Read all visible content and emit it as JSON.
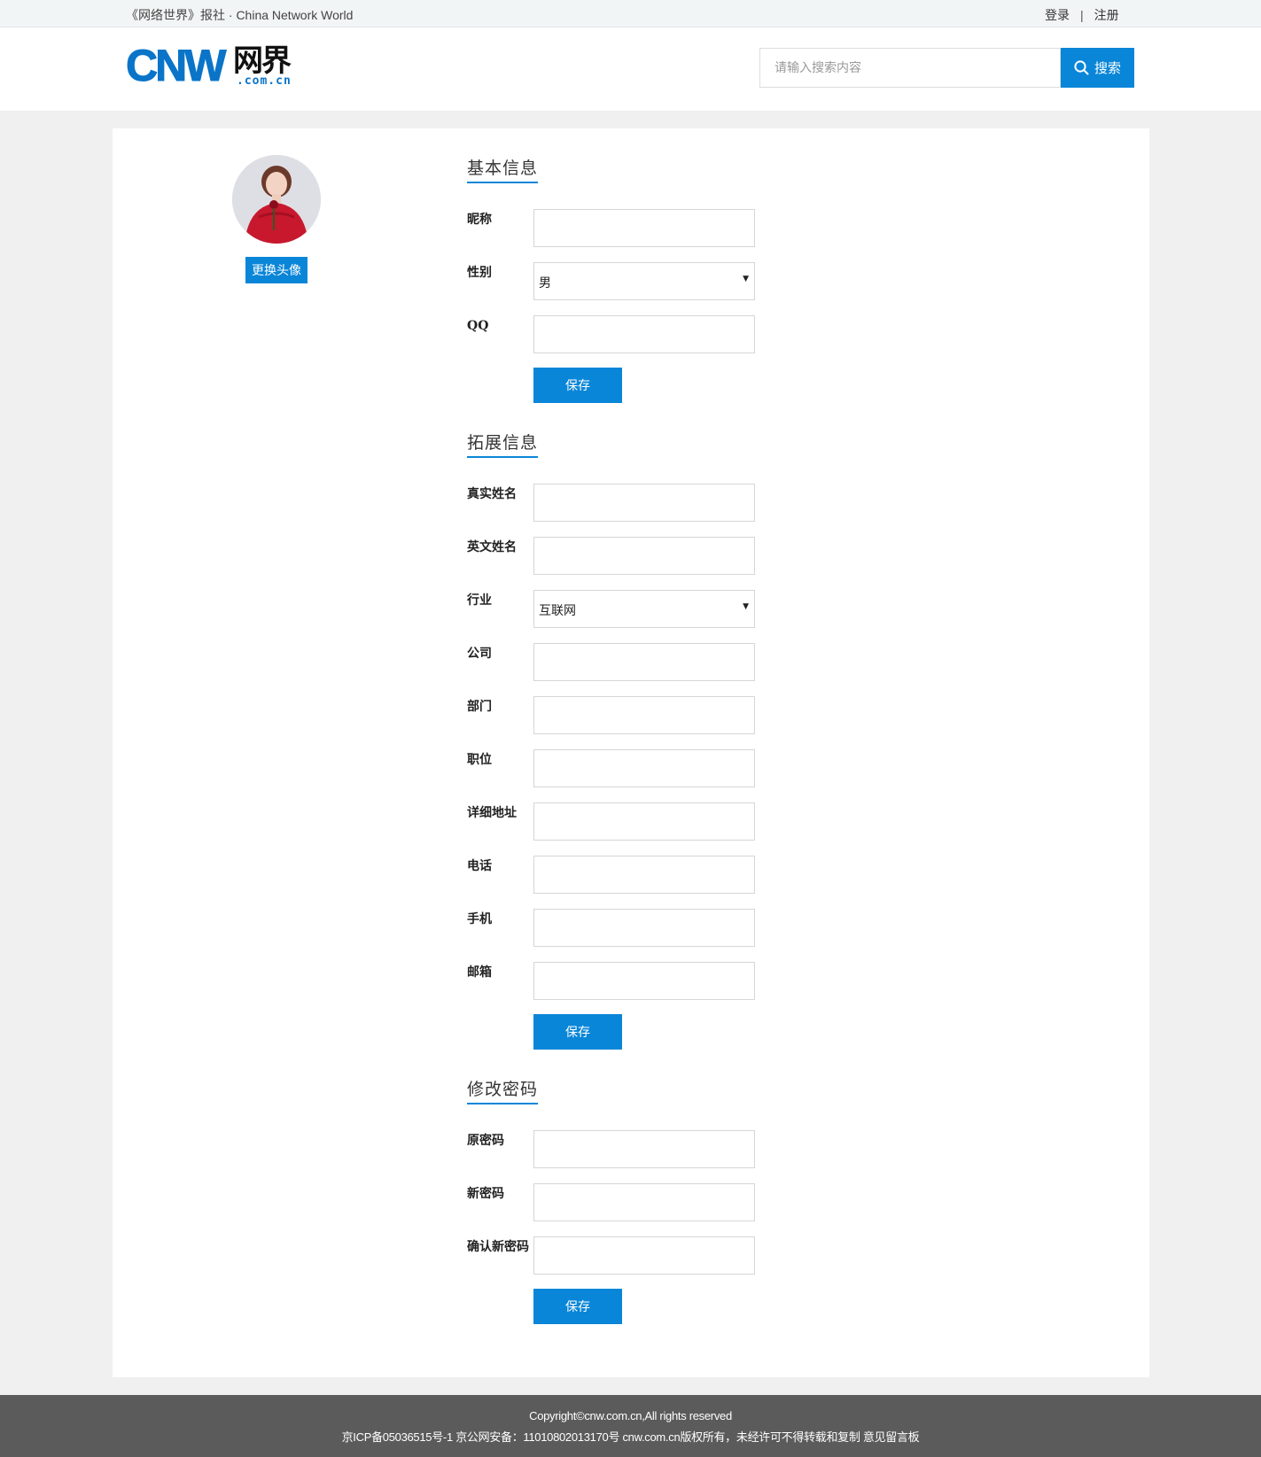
{
  "topbar": {
    "site_title": "《网络世界》报社 · China Network World",
    "login": "登录",
    "separator": "|",
    "register": "注册"
  },
  "header": {
    "logo": {
      "brand": "CNW",
      "chinese": "网界",
      "domain": ".com.cn"
    },
    "search": {
      "placeholder": "请输入搜索内容",
      "button_label": "搜索",
      "icon": "search-icon"
    }
  },
  "profile": {
    "change_avatar_label": "更换头像"
  },
  "basic_info": {
    "title": "基本信息",
    "nickname_label": "昵称",
    "nickname_value": "",
    "gender_label": "性别",
    "gender_value": "男",
    "qq_label": "QQ",
    "qq_value": "",
    "save_label": "保存"
  },
  "extended_info": {
    "title": "拓展信息",
    "real_name_label": "真实姓名",
    "english_name_label": "英文姓名",
    "industry_label": "行业",
    "industry_value": "互联网",
    "company_label": "公司",
    "department_label": "部门",
    "position_label": "职位",
    "address_label": "详细地址",
    "phone_label": "电话",
    "mobile_label": "手机",
    "email_label": "邮箱",
    "save_label": "保存"
  },
  "change_password": {
    "title": "修改密码",
    "old_password_label": "原密码",
    "new_password_label": "新密码",
    "confirm_password_label": "确认新密码",
    "save_label": "保存"
  },
  "footer": {
    "copyright": "Copyright©cnw.com.cn,All rights reserved",
    "icp": "京ICP备05036515号-1 京公网安备：11010802013170号 cnw.com.cn版权所有，未经许可不得转载和复制 意见留言板"
  },
  "colors": {
    "accent": "#0a86d8",
    "footer_bg": "#5b5b5b",
    "page_bg": "#f0f0f0"
  }
}
